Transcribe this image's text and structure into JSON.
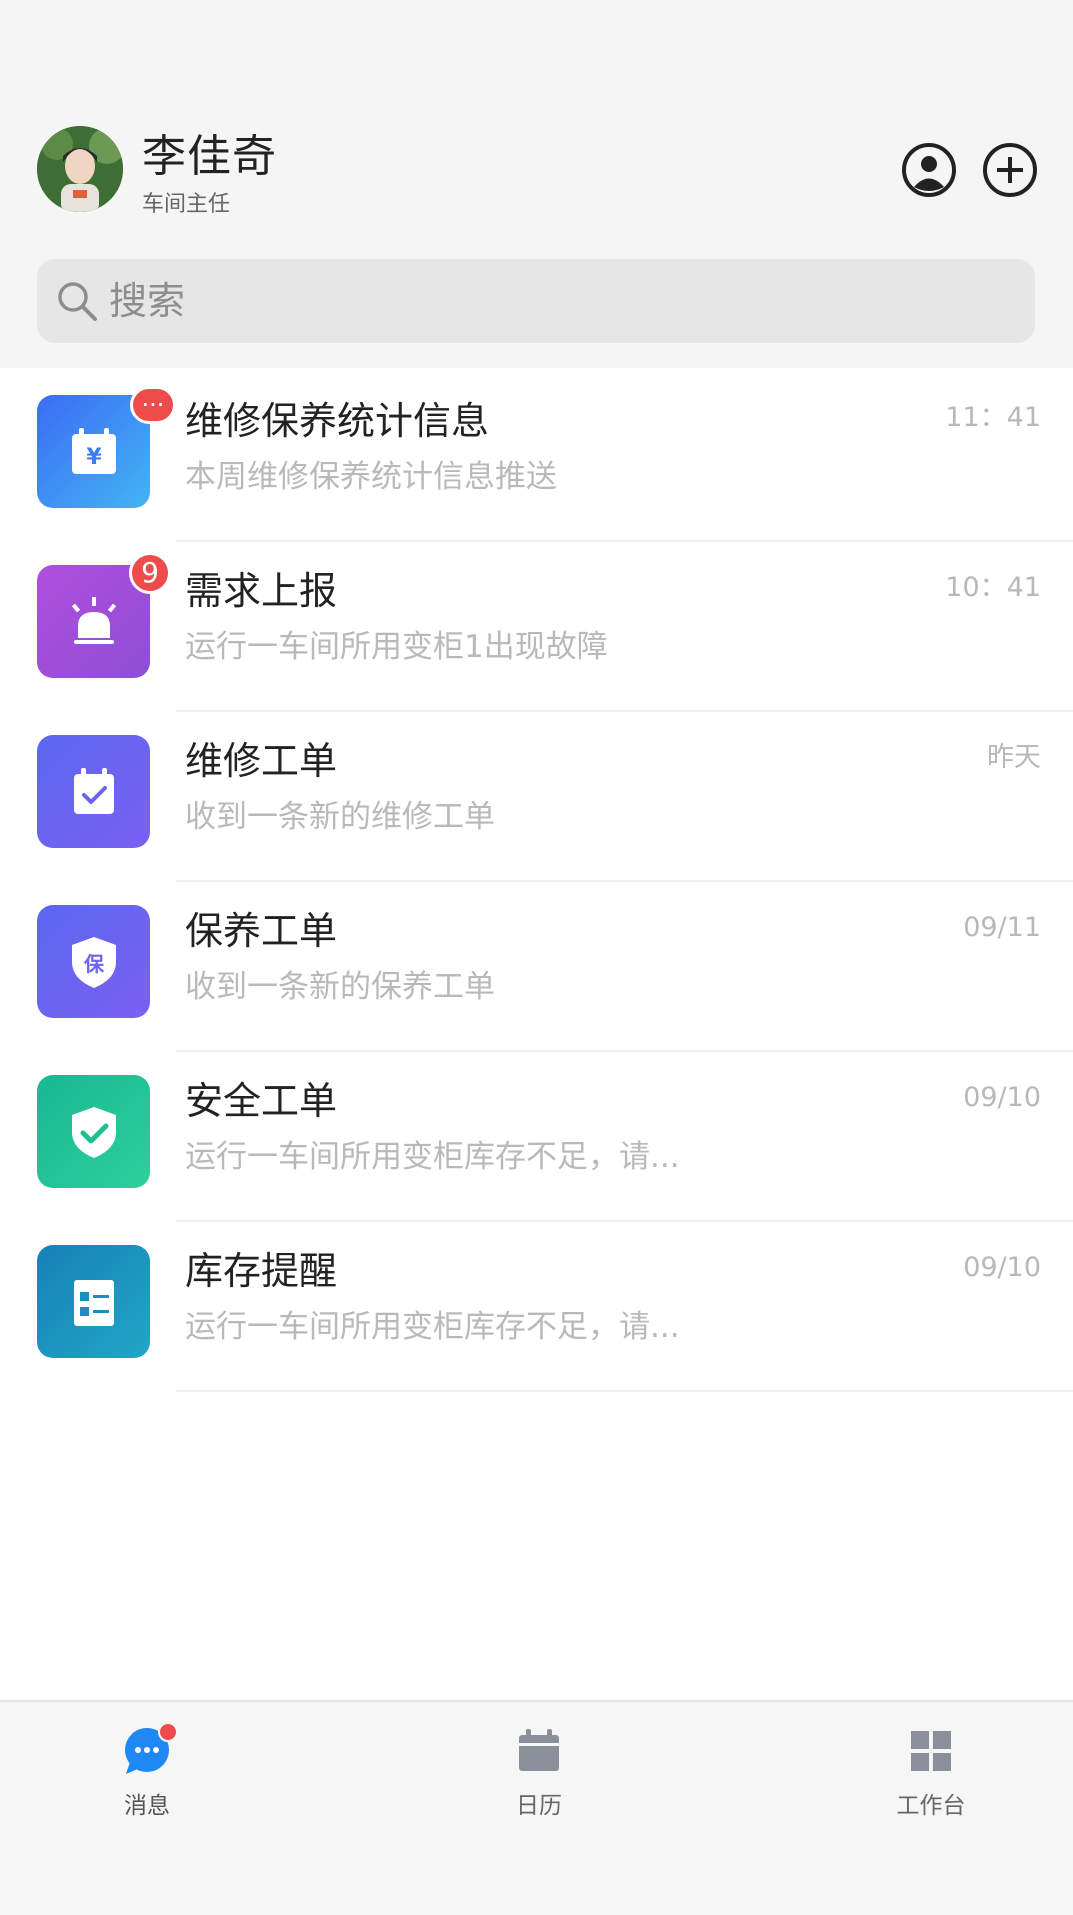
{
  "user": {
    "name": "李佳奇",
    "role": "车间主任"
  },
  "header": {
    "profile_icon": "user-circle-icon",
    "add_icon": "plus-circle-icon"
  },
  "search": {
    "placeholder": "搜索"
  },
  "messages": [
    {
      "title": "维修保养统计信息",
      "subtitle": "本周维修保养统计信息推送",
      "time": "11：41",
      "badge": "···",
      "icon": "calendar-yen-icon",
      "color": "#3d7cf5"
    },
    {
      "title": "需求上报",
      "subtitle": "运行一车间所用变柜1出现故障",
      "time": "10：41",
      "badge": "9",
      "icon": "alarm-light-icon",
      "color": "#a64fd8"
    },
    {
      "title": "维修工单",
      "subtitle": "收到一条新的维修工单",
      "time": "昨天",
      "badge": "",
      "icon": "calendar-check-icon",
      "color": "#6b63f1"
    },
    {
      "title": "保养工单",
      "subtitle": "收到一条新的保养工单",
      "time": "09/11",
      "badge": "",
      "icon": "shield-bao-icon",
      "color": "#6b63f1"
    },
    {
      "title": "安全工单",
      "subtitle": "运行一车间所用变柜库存不足，请...",
      "time": "09/10",
      "badge": "",
      "icon": "shield-check-icon",
      "color": "#1fbf94"
    },
    {
      "title": "库存提醒",
      "subtitle": "运行一车间所用变柜库存不足，请...",
      "time": "09/10",
      "badge": "",
      "icon": "checklist-icon",
      "color": "#1b8dbf"
    }
  ],
  "tabbar": {
    "tabs": [
      {
        "label": "消息",
        "icon": "chat-bubble-icon",
        "active": true,
        "dot": true
      },
      {
        "label": "日历",
        "icon": "calendar-icon",
        "active": false
      },
      {
        "label": "工作台",
        "icon": "grid-icon",
        "active": false
      }
    ]
  },
  "colors": {
    "accent": "#1e88f5",
    "badge": "#ee4b4b",
    "tab_inactive": "#8a8f99"
  }
}
